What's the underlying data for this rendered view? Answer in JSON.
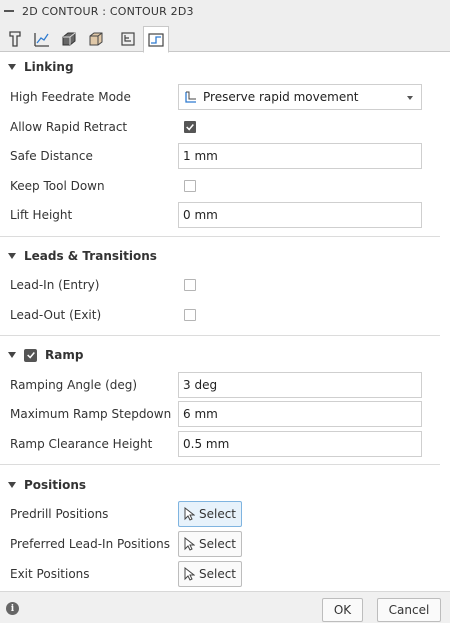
{
  "window": {
    "title": "2D CONTOUR : CONTOUR 2D3"
  },
  "tabs": [
    {
      "icon": "tool-icon"
    },
    {
      "icon": "geometry-icon"
    },
    {
      "icon": "heights-icon"
    },
    {
      "icon": "passes-icon"
    },
    {
      "icon": "linking-list-icon"
    },
    {
      "icon": "linking-icon",
      "active": true
    }
  ],
  "sections": {
    "linking": {
      "title": "Linking",
      "high_feedrate": {
        "label": "High Feedrate Mode",
        "value": "Preserve rapid movement"
      },
      "allow_rapid_retract": {
        "label": "Allow Rapid Retract",
        "checked": true
      },
      "safe_distance": {
        "label": "Safe Distance",
        "value": "1 mm"
      },
      "keep_tool_down": {
        "label": "Keep Tool Down",
        "checked": false
      },
      "lift_height": {
        "label": "Lift Height",
        "value": "0 mm"
      }
    },
    "leads": {
      "title": "Leads & Transitions",
      "lead_in": {
        "label": "Lead-In (Entry)",
        "checked": false
      },
      "lead_out": {
        "label": "Lead-Out (Exit)",
        "checked": false
      }
    },
    "ramp": {
      "title": "Ramp",
      "enabled": true,
      "ramping_angle": {
        "label": "Ramping Angle (deg)",
        "value": "3 deg"
      },
      "max_ramp_stepdown": {
        "label": "Maximum Ramp Stepdown",
        "value": "6 mm"
      },
      "ramp_clearance": {
        "label": "Ramp Clearance Height",
        "value": "0.5 mm"
      }
    },
    "positions": {
      "title": "Positions",
      "predrill": {
        "label": "Predrill Positions",
        "button": "Select"
      },
      "preferred_lead_in": {
        "label": "Preferred Lead-In Positions",
        "button": "Select"
      },
      "exit": {
        "label": "Exit Positions",
        "button": "Select"
      }
    }
  },
  "footer": {
    "ok_label": "OK",
    "cancel_label": "Cancel"
  },
  "colors": {
    "accent": "#4a90d9",
    "select_highlight": "#e7f2fb",
    "checkbox_checked": "#555555"
  }
}
